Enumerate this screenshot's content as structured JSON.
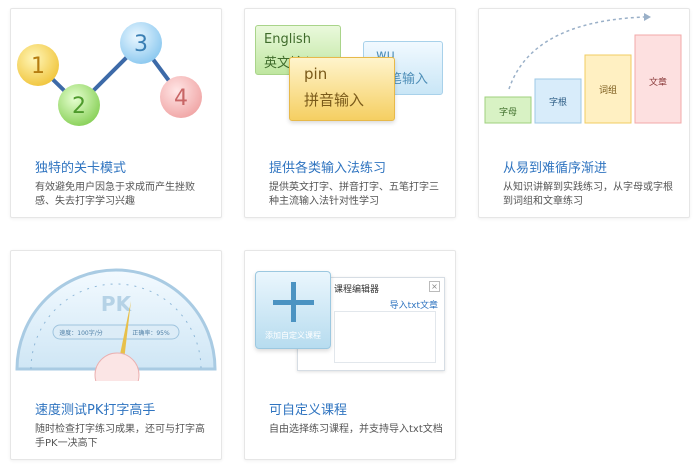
{
  "colors": {
    "title": "#2f74c0",
    "accent_green": "#8fd16a",
    "accent_yellow": "#f5cf55"
  },
  "cards": [
    {
      "title": "独特的关卡模式",
      "desc": "有效避免用户因急于求成而产生挫败感、失去打字学习兴趣",
      "nodes": [
        "1",
        "2",
        "3",
        "4"
      ]
    },
    {
      "title": "提供各类输入法练习",
      "desc": "提供英文打字、拼音打字、五笔打字三种主流输入法针对性学习",
      "boxes": {
        "en_line1": "English",
        "en_line2": "英文输入",
        "wu_line1": "wu",
        "wu_line2": "五笔输入",
        "pin_line1": "pin",
        "pin_line2": "拼音输入"
      }
    },
    {
      "title": "从易到难循序渐进",
      "desc": "从知识讲解到实践练习，从字母或字根到词组和文章练习",
      "levels": [
        "字母",
        "字根",
        "词组",
        "文章"
      ]
    },
    {
      "title": "速度测试PK打字高手",
      "desc": "随时检查打字练习成果，还可与打字高手PK一决高下",
      "gauge": {
        "label": "PK",
        "speed": "速度：100字/分",
        "accuracy": "正确率：95%"
      }
    },
    {
      "title": "可自定义课程",
      "desc": "自由选择练习课程，并支持导入txt文档",
      "editor": {
        "window_title": "课程编辑器",
        "import_link": "导入txt文章",
        "add_label": "添加自定义课程"
      }
    }
  ]
}
